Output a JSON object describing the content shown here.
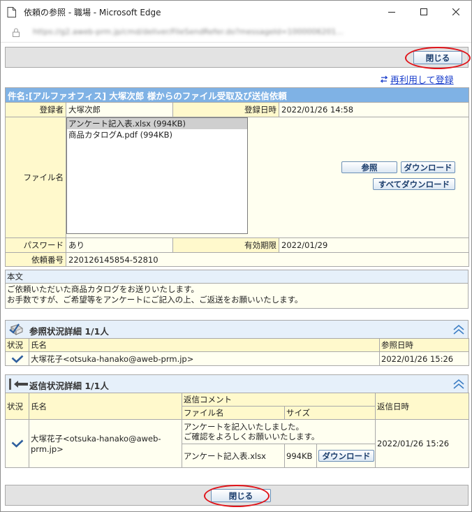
{
  "window": {
    "title": "依頼の参照 - 職場 - Microsoft Edge",
    "url": "https://g2.aweb-prm.jp/cmd/deliver/FileSendRefer.do?messageId=1000006201..."
  },
  "toolbar": {
    "close_label": "閉じる",
    "reuse_label": "再利用して登録"
  },
  "request": {
    "subject": "件名:[アルファオフィス] 大塚次郎 様からのファイル受取及び送信依頼",
    "registrant_label": "登録者",
    "registrant": "大塚次郎",
    "registered_at_label": "登録日時",
    "registered_at": "2022/01/26 14:58",
    "file_label": "ファイル名",
    "files": [
      "アンケート記入表.xlsx (994KB)",
      "商品カタログA.pdf (994KB)"
    ],
    "view_button": "参照",
    "download_button": "ダウンロード",
    "download_all_button": "すべてダウンロード",
    "password_label": "パスワード",
    "password": "あり",
    "expiry_label": "有効期限",
    "expiry": "2022/01/29",
    "request_no_label": "依頼番号",
    "request_no": "220126145854-52810"
  },
  "body": {
    "label": "本文",
    "line1": "ご依頼いただいた商品カタログをお送りいたします。",
    "line2": "お手数ですが、ご希望等をアンケートにご記入の上、ご返送をお願いいたします。"
  },
  "reference": {
    "title": "参照状況詳細 1/1人",
    "col_status": "状況",
    "col_name": "氏名",
    "col_date": "参照日時",
    "rows": [
      {
        "name": "大塚花子<otsuka-hanako@aweb-prm.jp>",
        "date": "2022/01/26 15:26"
      }
    ]
  },
  "reply": {
    "title": "返信状況詳細 1/1人",
    "col_status": "状況",
    "col_name": "氏名",
    "col_comment": "返信コメント",
    "col_file": "ファイル名",
    "col_size": "サイズ",
    "col_date": "返信日時",
    "rows": [
      {
        "name": "大塚花子<otsuka-hanako@aweb-prm.jp>",
        "comment_line1": "アンケートを記入いたしました。",
        "comment_line2": "ご確認をよろしくお願いいたします。",
        "file": "アンケート記入表.xlsx",
        "size": "994KB",
        "download": "ダウンロード",
        "date": "2022/01/26 15:26"
      }
    ]
  },
  "colors": {
    "header_blue": "#7fb2e5",
    "label_bg": "#fff9cc",
    "highlight_ring": "#e0141a"
  }
}
